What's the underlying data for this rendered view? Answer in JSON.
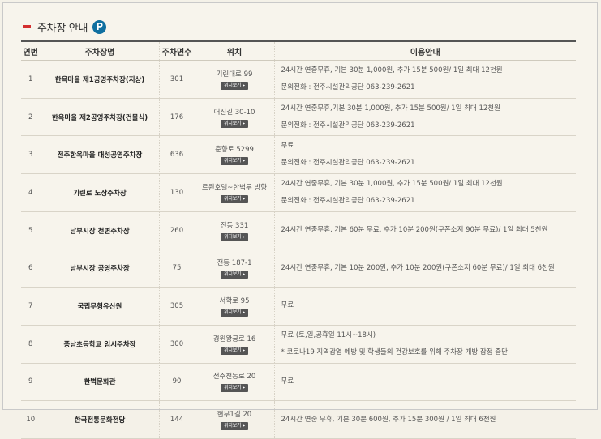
{
  "header": {
    "title": "주차장 안내",
    "icon_letter": "P"
  },
  "table": {
    "columns": [
      "연번",
      "주차장명",
      "주차면수",
      "위치",
      "이용안내"
    ],
    "rows": [
      {
        "no": "1",
        "name": "한옥마을 제1공영주차장(지상)",
        "spaces": "301",
        "location": "기린대로 99",
        "map_label": "위치보기 ▸",
        "info": [
          "24시간 연중무휴, 기본 30분 1,000원, 추가 15분 500원/ 1일 최대 12천원",
          "문의전화 : 전주시설관리공단 063-239-2621"
        ]
      },
      {
        "no": "2",
        "name": "한옥마을 제2공영주차장(건물식)",
        "spaces": "176",
        "location": "어진길 30-10",
        "map_label": "위치보기 ▸",
        "info": [
          "24시간 연중무휴,기본 30분 1,000원, 추가 15분 500원/ 1일 최대 12천원",
          "문의전화 : 전주시설관리공단 063-239-2621"
        ]
      },
      {
        "no": "3",
        "name": "전주한옥마을 대성공영주차장",
        "spaces": "636",
        "location": "춘향로 5299",
        "map_label": "위치보기 ▸",
        "info": [
          "무료",
          "문의전화 : 전주시설관리공단 063-239-2621"
        ]
      },
      {
        "no": "4",
        "name": "기린로 노상주차장",
        "spaces": "130",
        "location": "르윈호텔~한벽루 방향",
        "map_label": "위치보기 ▸",
        "info": [
          "24시간 연중무휴, 기본 30분 1,000원, 추가 15분 500원/ 1일 최대 12천원",
          "문의전화 : 전주시설관리공단 063-239-2621"
        ]
      },
      {
        "no": "5",
        "name": "남부시장 천변주차장",
        "spaces": "260",
        "location": "전동 331",
        "map_label": "위치보기 ▸",
        "info": [
          "24시간 연중무휴, 기본 60분 무료, 추가 10분 200원(쿠폰소지 90분 무료)/ 1일 최대 5천원"
        ]
      },
      {
        "no": "6",
        "name": "남부시장 공영주차장",
        "spaces": "75",
        "location": "전동 187-1",
        "map_label": "위치보기 ▸",
        "info": [
          "24시간 연중무휴, 기본 10분 200원, 추가 10분 200원(쿠폰소지 60분 무료)/ 1일 최대 6천원"
        ]
      },
      {
        "no": "7",
        "name": "국립무형유산원",
        "spaces": "305",
        "location": "서학로 95",
        "map_label": "위치보기 ▸",
        "info": [
          "무료"
        ]
      },
      {
        "no": "8",
        "name": "풍남초등학교 임시주차장",
        "spaces": "300",
        "location": "경원왕궁로 16",
        "map_label": "위치보기 ▸",
        "info": [
          "무료 (토,일,공휴일 11시~18시)",
          "* 코로나19 지역감염 예방 및 학생들의 건강보호를 위해 주차장 개방 잠정 중단"
        ]
      },
      {
        "no": "9",
        "name": "한벽문화관",
        "spaces": "90",
        "location": "전주천동로 20",
        "map_label": "위치보기 ▸",
        "info": [
          "무료"
        ]
      },
      {
        "no": "10",
        "name": "한국전통문화전당",
        "spaces": "144",
        "location": "현무1길 20",
        "map_label": "위치보기 ▸",
        "info": [
          "24시간 연중 무휴, 기본 30분 600원, 추가 15분 300원 / 1일 최대 6천원"
        ]
      }
    ]
  }
}
